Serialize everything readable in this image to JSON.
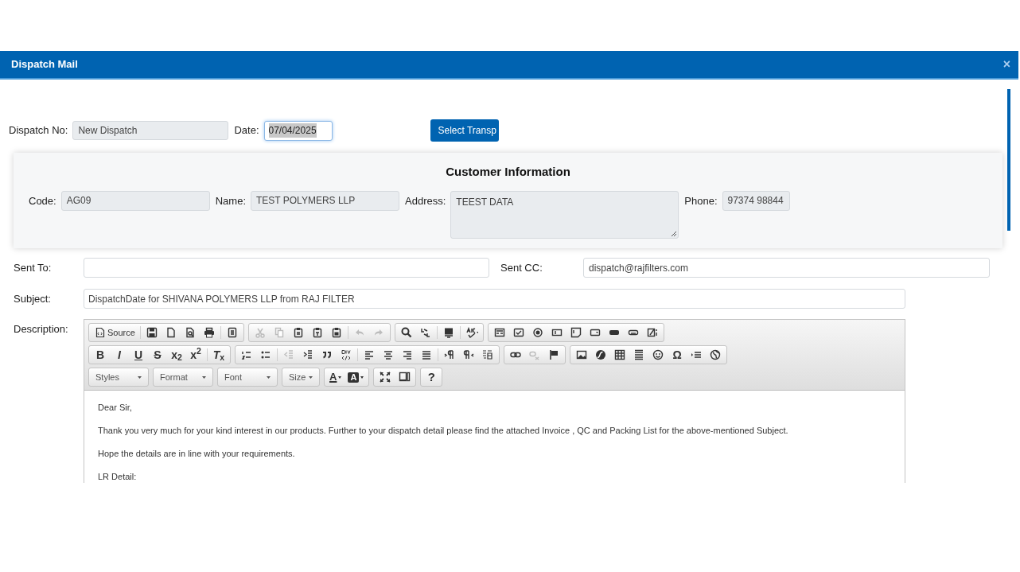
{
  "window": {
    "title": "Dispatch Mail",
    "close": "×"
  },
  "header_form": {
    "dispatch_no": {
      "label": "Dispatch No:",
      "value": "New Dispatch"
    },
    "date": {
      "label": "Date:",
      "value": "07/04/2025",
      "focused": true,
      "text_selected": true
    },
    "button": "Select Transp"
  },
  "customer": {
    "title": "Customer Information",
    "fields": [
      {
        "label": "Code:",
        "value": "AG09",
        "kind": "input"
      },
      {
        "label": "Name:",
        "value": "TEST POLYMERS LLP",
        "kind": "input"
      },
      {
        "label": "Address:",
        "value": "TEEST DATA",
        "kind": "textarea"
      },
      {
        "label": "Phone:",
        "value": "97374 98844",
        "kind": "input"
      }
    ]
  },
  "sent_to": {
    "label": "Sent To:"
  },
  "sent_cc": {
    "label": "Sent CC:",
    "value": "dispatch@rajfilters.com"
  },
  "subject": {
    "label": "Subject:",
    "value": "DispatchDate for SHIVANA POLYMERS LLP from RAJ FILTER"
  },
  "description": {
    "label": "Description:"
  },
  "editor": {
    "toolbar": [
      [
        [
          {
            "kind": "button",
            "label": "Source",
            "disabled": false
          },
          {
            "kind": "separator"
          },
          {
            "kind": "icon",
            "disabled": false
          },
          {
            "kind": "icon",
            "disabled": false
          },
          {
            "kind": "icon",
            "disabled": false
          },
          {
            "kind": "icon",
            "disabled": false
          },
          {
            "kind": "separator"
          },
          {
            "kind": "icon",
            "disabled": false
          }
        ],
        [
          {
            "kind": "icon",
            "disabled": true
          },
          {
            "kind": "icon",
            "disabled": true
          },
          {
            "kind": "icon",
            "disabled": false
          },
          {
            "kind": "icon",
            "disabled": false
          },
          {
            "kind": "icon",
            "disabled": false
          },
          {
            "kind": "separator"
          },
          {
            "kind": "icon",
            "disabled": true
          },
          {
            "kind": "icon",
            "disabled": true
          }
        ],
        [
          {
            "kind": "icon",
            "disabled": false
          },
          {
            "kind": "icon",
            "disabled": false
          },
          {
            "kind": "separator"
          },
          {
            "kind": "icon",
            "disabled": false
          },
          {
            "kind": "separator"
          },
          {
            "kind": "icon",
            "disabled": false
          }
        ],
        [
          {
            "kind": "icon",
            "disabled": false
          },
          {
            "kind": "icon",
            "disabled": false
          },
          {
            "kind": "icon",
            "disabled": false
          },
          {
            "kind": "icon",
            "disabled": false
          },
          {
            "kind": "icon",
            "disabled": false
          },
          {
            "kind": "icon",
            "disabled": false
          },
          {
            "kind": "icon",
            "disabled": false
          },
          {
            "kind": "icon",
            "disabled": false
          },
          {
            "kind": "icon",
            "disabled": false
          }
        ]
      ],
      [
        [
          {
            "kind": "text",
            "label": "**B**",
            "disabled": false
          },
          {
            "kind": "text",
            "label": "*I*",
            "disabled": false
          },
          {
            "kind": "text",
            "label": "U",
            "disabled": false
          },
          {
            "kind": "text",
            "label": "S",
            "disabled": false
          },
          {
            "kind": "text",
            "label": "x$_{2}$",
            "disabled": false
          },
          {
            "kind": "text",
            "label": "x$^{2}$",
            "disabled": false
          },
          {
            "kind": "separator"
          },
          {
            "kind": "text",
            "label": "*T*$_{x}$",
            "disabled": false
          }
        ],
        [
          {
            "kind": "icon",
            "disabled": false
          },
          {
            "kind": "icon",
            "disabled": false
          },
          {
            "kind": "separator"
          },
          {
            "kind": "icon",
            "disabled": true
          },
          {
            "kind": "icon",
            "disabled": false
          },
          {
            "kind": "icon",
            "disabled": false
          },
          {
            "kind": "icon",
            "disabled": false
          },
          {
            "kind": "separator"
          },
          {
            "kind": "icon",
            "disabled": false
          },
          {
            "kind": "icon",
            "disabled": false
          },
          {
            "kind": "icon",
            "disabled": false
          },
          {
            "kind": "icon",
            "disabled": false
          },
          {
            "kind": "separator"
          },
          {
            "kind": "icon",
            "disabled": false
          },
          {
            "kind": "icon",
            "disabled": false
          },
          {
            "kind": "icon",
            "disabled": false
          }
        ],
        [
          {
            "kind": "icon",
            "disabled": false
          },
          {
            "kind": "icon",
            "disabled": true
          },
          {
            "kind": "icon",
            "disabled": false
          }
        ],
        [
          {
            "kind": "icon",
            "disabled": false
          },
          {
            "kind": "icon",
            "disabled": false
          },
          {
            "kind": "icon",
            "disabled": false
          },
          {
            "kind": "icon",
            "disabled": false
          },
          {
            "kind": "icon",
            "disabled": false
          },
          {
            "kind": "text",
            "label": "Ω",
            "disabled": false
          },
          {
            "kind": "icon",
            "disabled": false
          },
          {
            "kind": "icon",
            "disabled": false
          }
        ]
      ],
      [
        [
          {
            "kind": "combo",
            "label": "Styles"
          }
        ],
        [
          {
            "kind": "combo",
            "label": "Format"
          }
        ],
        [
          {
            "kind": "combo",
            "label": "Font"
          }
        ],
        [
          {
            "kind": "combo",
            "label": "Size"
          }
        ],
        [
          {
            "kind": "textcolor",
            "label": "A",
            "disabled": false
          },
          {
            "kind": "bgcolor",
            "label": "A",
            "disabled": false
          }
        ],
        [
          {
            "kind": "icon",
            "disabled": false
          },
          {
            "kind": "icon",
            "disabled": false
          }
        ],
        [
          {
            "kind": "text",
            "label": "?",
            "disabled": false
          }
        ]
      ]
    ],
    "body": [
      "Dear Sir,",
      "Thank you very much for your kind interest in our products. Further to your dispatch detail please find the attached Invoice , QC and Packing List for the above-mentioned Subject.",
      "Hope the details are in line with your requirements.",
      "LR Detail:"
    ]
  }
}
